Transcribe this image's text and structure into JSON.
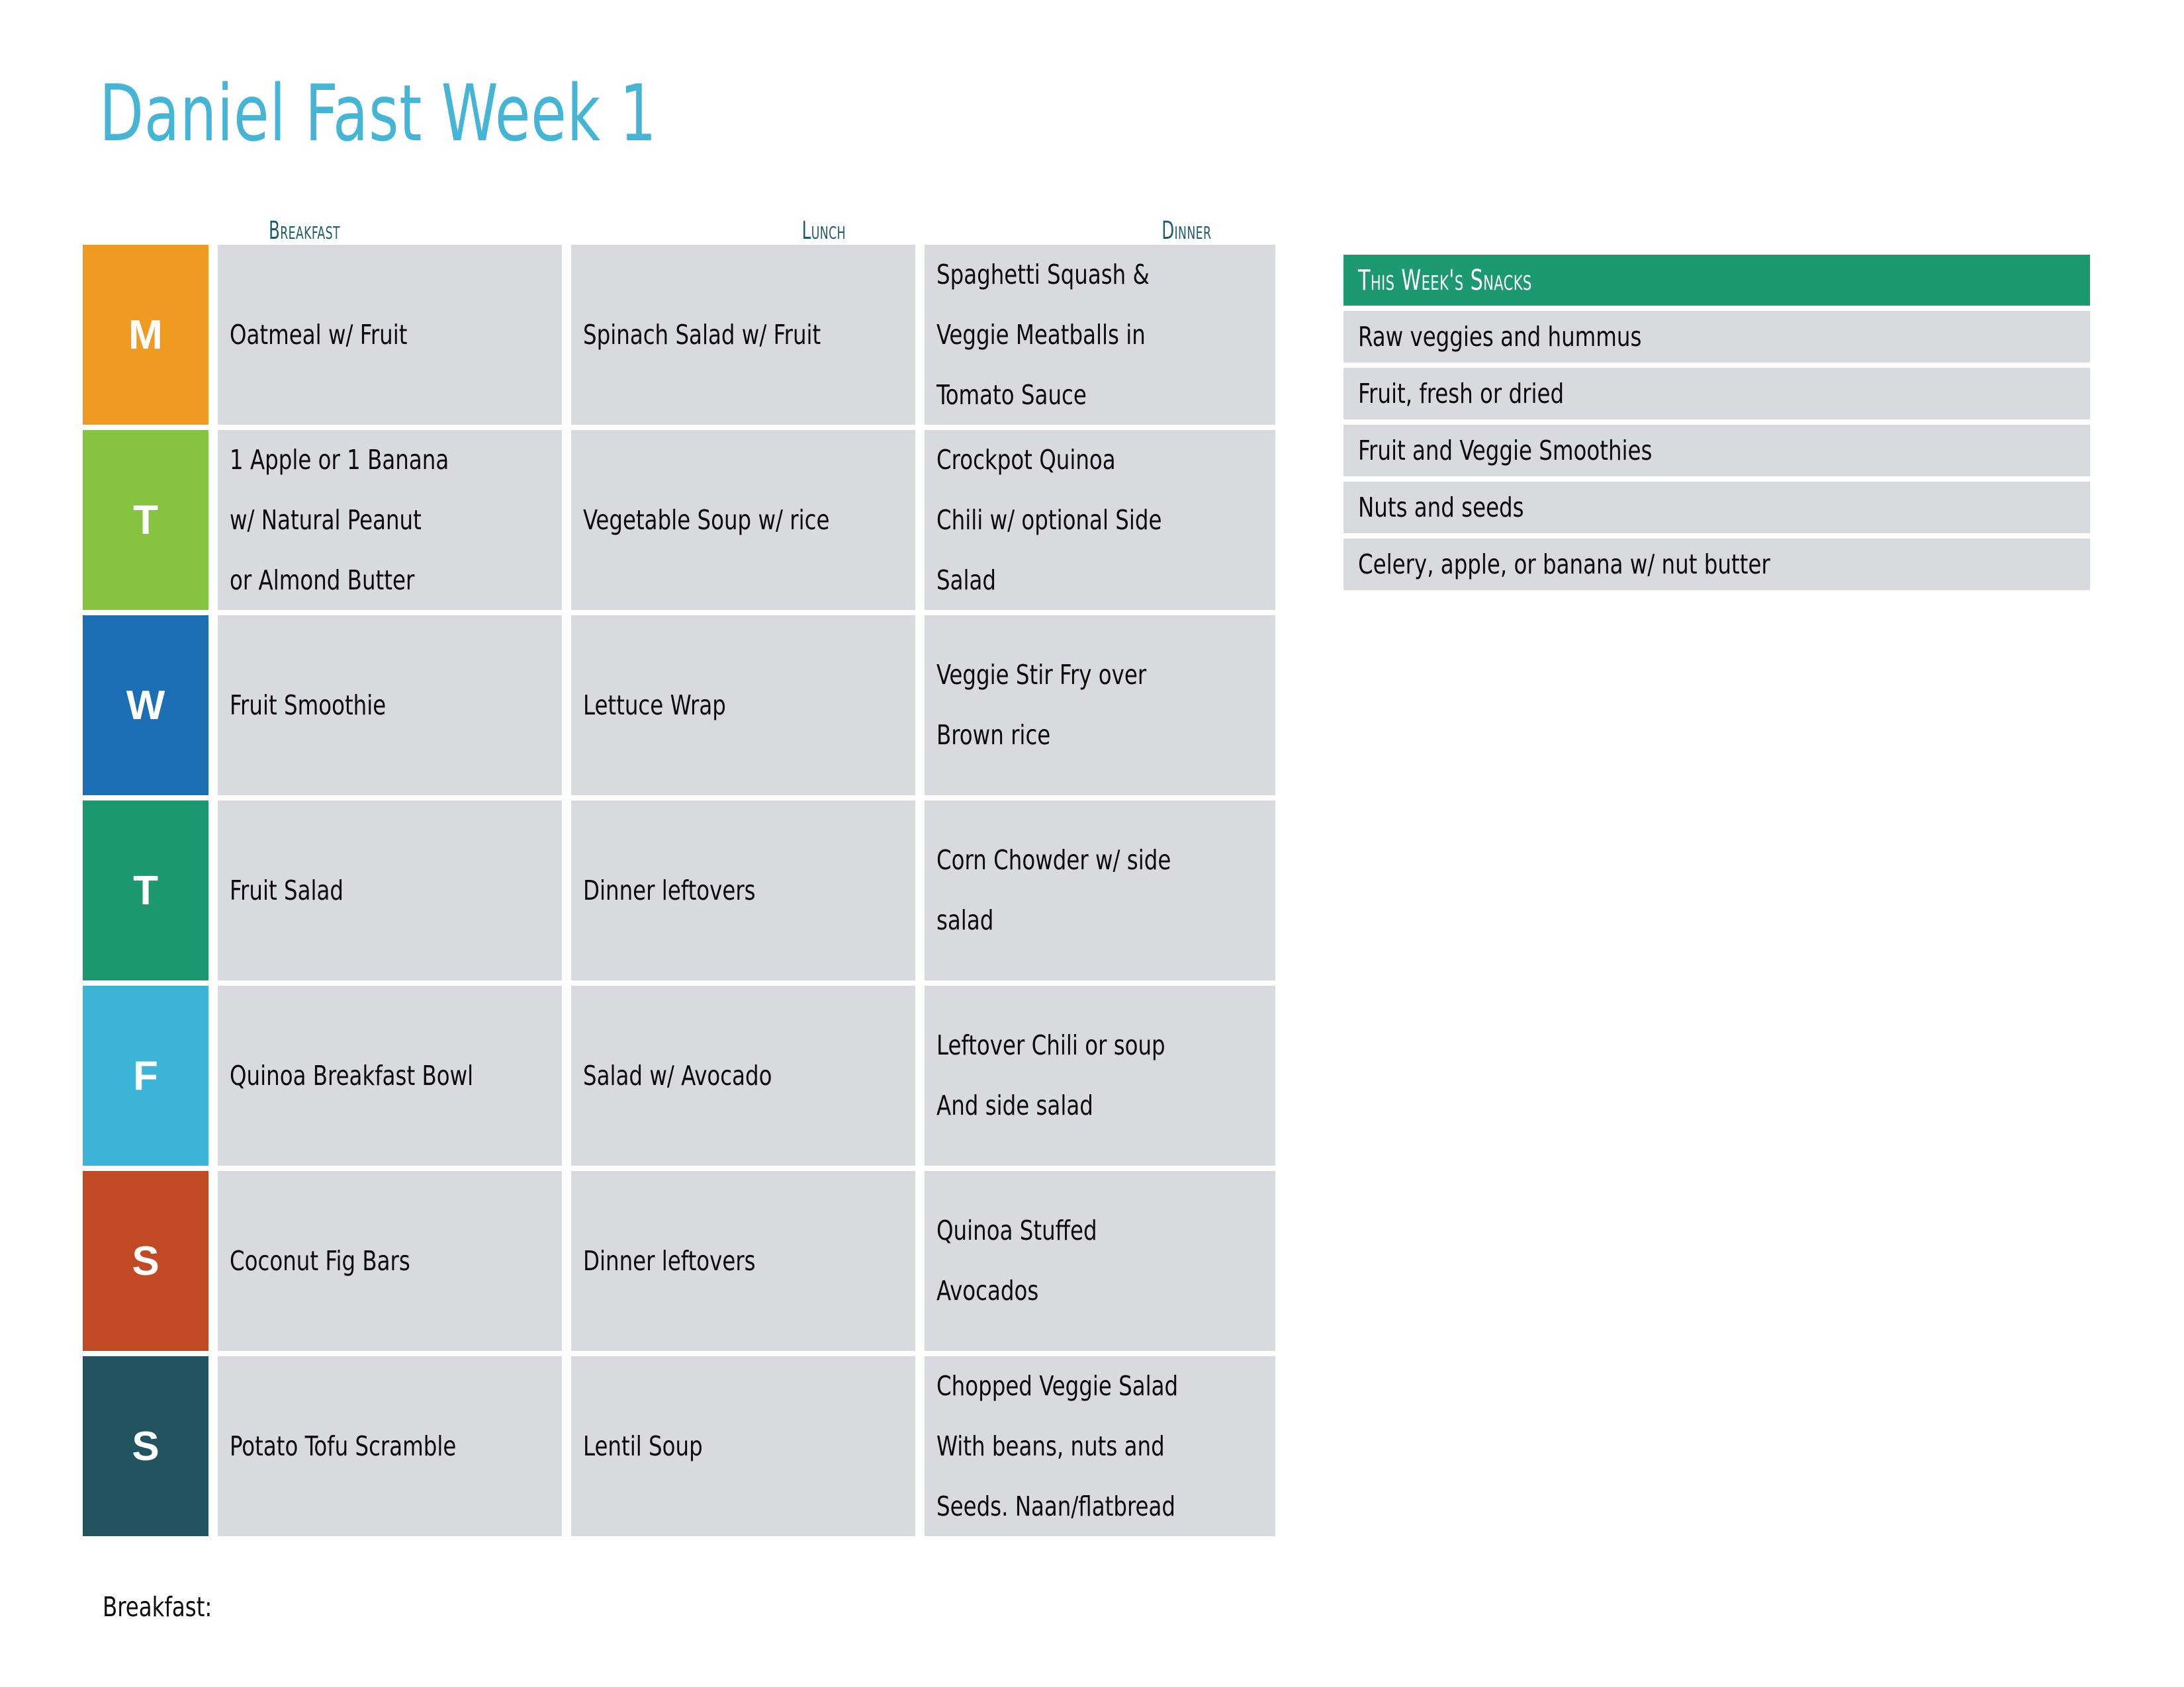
{
  "title": "Daniel Fast Week 1",
  "colors": {
    "title": "#45B4D5",
    "header_text": "#1F5C6B",
    "cell_bg": "#D7DADE",
    "snacks_header_bg": "#1C9971",
    "page_bg": "#FFFFFF"
  },
  "table": {
    "column_headers": [
      "Breakfast",
      "Lunch",
      "Dinner"
    ],
    "rows": [
      {
        "day_letter": "M",
        "day_color": "#EF9A20",
        "breakfast": [
          "Oatmeal w/ Fruit"
        ],
        "lunch": [
          "Spinach Salad w/ Fruit"
        ],
        "dinner": [
          "Spaghetti Squash &",
          "Veggie Meatballs in",
          "Tomato Sauce"
        ]
      },
      {
        "day_letter": "T",
        "day_color": "#86C440",
        "breakfast": [
          "1 Apple or 1 Banana",
          "w/ Natural Peanut",
          "or Almond Butter"
        ],
        "lunch": [
          "Vegetable Soup w/ rice"
        ],
        "dinner": [
          "Crockpot Quinoa",
          "Chili w/ optional Side",
          "Salad"
        ]
      },
      {
        "day_letter": "W",
        "day_color": "#1C6FB4",
        "breakfast": [
          "Fruit Smoothie"
        ],
        "lunch": [
          "Lettuce Wrap"
        ],
        "dinner": [
          "Veggie Stir Fry over",
          "Brown rice"
        ]
      },
      {
        "day_letter": "T",
        "day_color": "#1C9971",
        "breakfast": [
          "Fruit Salad"
        ],
        "lunch": [
          "Dinner leftovers"
        ],
        "dinner": [
          "Corn Chowder w/ side",
          "salad"
        ]
      },
      {
        "day_letter": "F",
        "day_color": "#3CB4D5",
        "breakfast": [
          "Quinoa Breakfast Bowl"
        ],
        "lunch": [
          "Salad w/ Avocado"
        ],
        "dinner": [
          "Leftover Chili or soup",
          "And side salad"
        ]
      },
      {
        "day_letter": "S",
        "day_color": "#C04A23",
        "breakfast": [
          "Coconut Fig Bars"
        ],
        "lunch": [
          "Dinner leftovers"
        ],
        "dinner": [
          "Quinoa Stuffed",
          "Avocados"
        ]
      },
      {
        "day_letter": "S",
        "day_color": "#21545F",
        "breakfast": [
          "Potato Tofu Scramble"
        ],
        "lunch": [
          "Lentil Soup"
        ],
        "dinner": [
          "Chopped Veggie Salad",
          "With beans, nuts and",
          "Seeds. Naan/flatbread"
        ]
      }
    ]
  },
  "snacks": {
    "header": "This Week's Snacks",
    "items": [
      "Raw veggies and hummus",
      "Fruit, fresh or dried",
      "Fruit and Veggie Smoothies",
      "Nuts and seeds",
      "Celery, apple, or banana w/ nut butter"
    ]
  },
  "footer": {
    "note": "Breakfast:"
  }
}
